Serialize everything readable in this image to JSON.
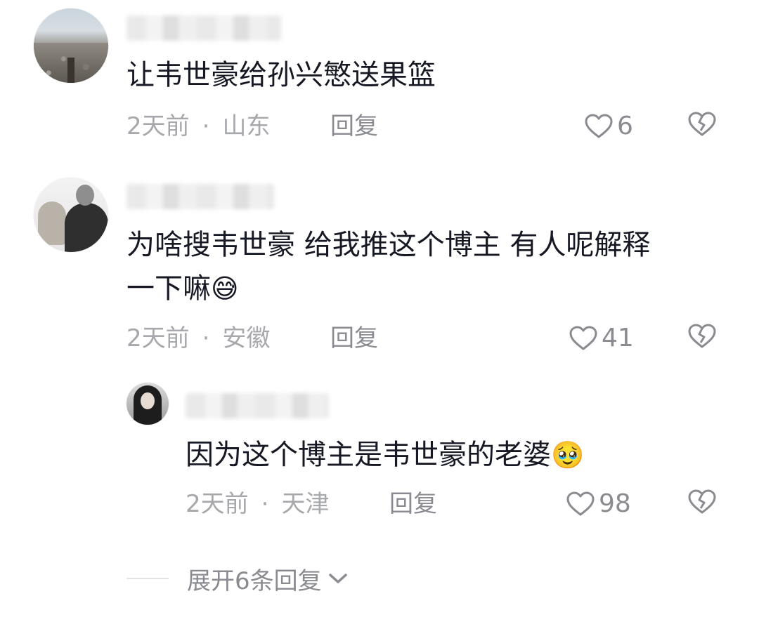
{
  "comments": [
    {
      "username": "",
      "text": "让韦世豪给孙兴慜送果篮",
      "emoji": "",
      "time": "2天前",
      "separator": "·",
      "location": "山东",
      "reply_label": "回复",
      "likes": "6"
    },
    {
      "username": "",
      "text_line1": "为啥搜韦世豪 给我推这个博主 有人呢解释",
      "text_line2": "一下嘛",
      "emoji": "😅",
      "time": "2天前",
      "separator": "·",
      "location": "安徽",
      "reply_label": "回复",
      "likes": "41"
    },
    {
      "username": "",
      "text": "因为这个博主是韦世豪的老婆",
      "emoji": "🥹",
      "time": "2天前",
      "separator": "·",
      "location": "天津",
      "reply_label": "回复",
      "likes": "98"
    }
  ],
  "expand_replies_label": "展开6条回复",
  "icons": {
    "like": "heart-outline-icon",
    "dislike": "broken-heart-icon",
    "expand": "chevron-down-icon"
  },
  "colors": {
    "text": "#161823",
    "meta": "#a7a8ac",
    "action": "#8a8b91"
  }
}
